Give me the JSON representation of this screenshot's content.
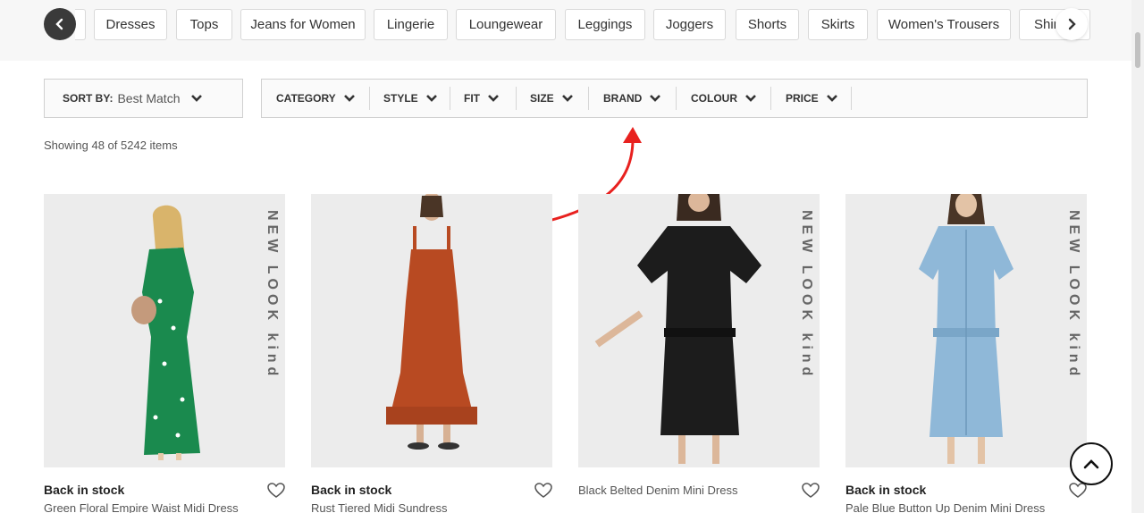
{
  "categories": [
    {
      "label": "Dresses"
    },
    {
      "label": "Tops"
    },
    {
      "label": "Jeans for Women"
    },
    {
      "label": "Lingerie"
    },
    {
      "label": "Loungewear"
    },
    {
      "label": "Leggings"
    },
    {
      "label": "Joggers"
    },
    {
      "label": "Shorts"
    },
    {
      "label": "Skirts"
    },
    {
      "label": "Women's Trousers"
    },
    {
      "label": "Shir"
    }
  ],
  "sort": {
    "label": "SORT BY:",
    "value": "Best Match"
  },
  "filters": [
    {
      "label": "CATEGORY"
    },
    {
      "label": "STYLE"
    },
    {
      "label": "FIT"
    },
    {
      "label": "SIZE"
    },
    {
      "label": "BRAND"
    },
    {
      "label": "COLOUR"
    },
    {
      "label": "PRICE"
    }
  ],
  "results_count": "Showing 48 of 5242 items",
  "products": [
    {
      "status": "Back in stock",
      "name": "Green Floral Empire Waist Midi Dress",
      "watermark": "NEW LOOK kind",
      "dress_color": "#1a8a4e"
    },
    {
      "status": "Back in stock",
      "name": "Rust Tiered Midi Sundress",
      "watermark": "",
      "dress_color": "#b84a22"
    },
    {
      "status": "",
      "name": "Black Belted Denim Mini Dress",
      "watermark": "NEW LOOK kind",
      "dress_color": "#1c1c1c"
    },
    {
      "status": "Back in stock",
      "name": "Pale Blue Button Up Denim Mini Dress",
      "watermark": "NEW LOOK kind",
      "dress_color": "#8fb8d8"
    }
  ],
  "colors": {
    "annotation_arrow": "#e8211f",
    "nav_dark": "#3a3a3a"
  },
  "icons": {
    "prev": "chevron-left-icon",
    "next": "chevron-right-icon",
    "dropdown": "chevron-down-icon",
    "wishlist": "heart-icon",
    "back_to_top": "chevron-up-icon"
  }
}
